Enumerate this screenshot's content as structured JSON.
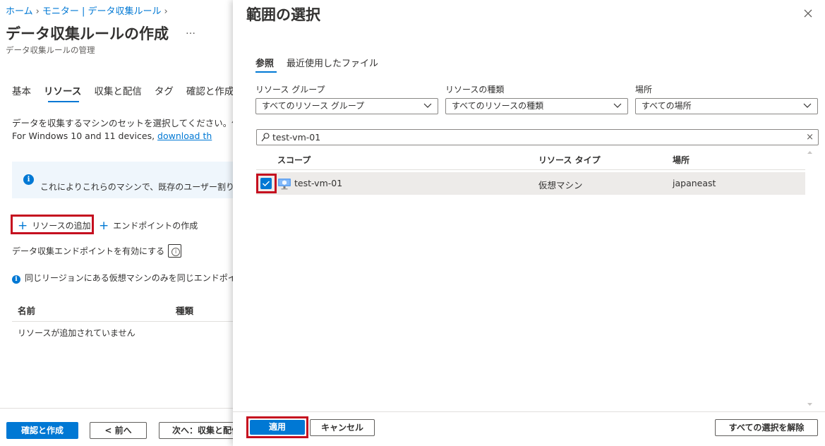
{
  "colors": {
    "accent": "#0078d4",
    "highlight_box": "#c50f1f",
    "selected_row": "#edebe9"
  },
  "breadcrumb": {
    "home": "ホーム",
    "monitor": "モニター | データ収集ルール",
    "chevron": "›"
  },
  "page": {
    "title": "データ収集ルールの作成",
    "more": "…",
    "subtitle": "データ収集ルールの管理"
  },
  "tabs": [
    "基本",
    "リソース",
    "収集と配信",
    "タグ",
    "確認と作成"
  ],
  "description": {
    "line1": "データを収集するマシンのセットを選択してください。仮想マ",
    "line2_prefix": "For Windows 10 and 11 devices, ",
    "line2_link": "download th"
  },
  "info_banner": {
    "icon": "info-icon",
    "text": "これによりこれらのマシンで、既存のユーザー割り当て ID (シ"
  },
  "actions": {
    "add_resource": "リソースの追加",
    "create_endpoint": "エンドポイントの作成"
  },
  "enable_endpoint": {
    "label": "データ収集エンドポイントを有効にする",
    "checked": false
  },
  "region_note": "同じリージョンにある仮想マシンのみを同じエンドポイントに",
  "resource_table": {
    "columns": [
      "名前",
      "種類"
    ],
    "empty_text": "リソースが追加されていません"
  },
  "footer_left": {
    "review_create": "確認と作成",
    "prev": "< 前へ",
    "next": "次へ：収集と配信 >"
  },
  "panel": {
    "title": "範囲の選択",
    "tabs": [
      "参照",
      "最近使用したファイル"
    ],
    "filters": [
      {
        "label": "リソース グループ",
        "value": "すべてのリソース グループ"
      },
      {
        "label": "リソースの種類",
        "value": "すべてのリソースの種類"
      },
      {
        "label": "場所",
        "value": "すべての場所"
      }
    ],
    "search": {
      "value": "test-vm-01",
      "clear": "×"
    },
    "grid": {
      "columns": [
        "スコープ",
        "リソース タイプ",
        "場所"
      ],
      "rows": [
        {
          "name": "test-vm-01",
          "type": "仮想マシン",
          "location": "japaneast",
          "selected": true,
          "icon": "virtual-machine-icon"
        }
      ]
    },
    "footer": {
      "apply": "適用",
      "cancel": "キャンセル",
      "clear_all": "すべての選択を解除"
    }
  }
}
